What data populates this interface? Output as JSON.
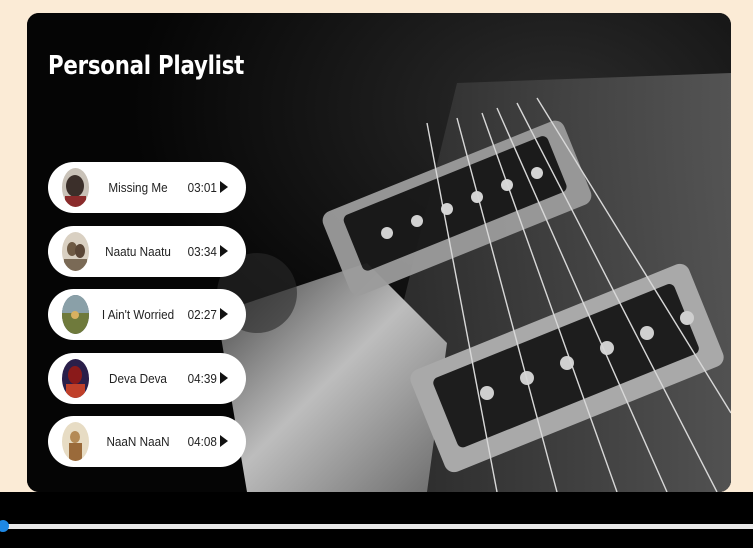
{
  "playlist": {
    "title": "Personal Playlist",
    "songs": [
      {
        "name": "Missing Me",
        "duration": "03:01",
        "thumb_colors": [
          "#3b2f2a",
          "#c9c2b8"
        ]
      },
      {
        "name": "Naatu Naatu",
        "duration": "03:34",
        "thumb_colors": [
          "#6e5a44",
          "#d9d0c2"
        ]
      },
      {
        "name": "I Ain't Worried",
        "duration": "02:27",
        "thumb_colors": [
          "#6f7a3c",
          "#2f4a5a"
        ]
      },
      {
        "name": "Deva Deva",
        "duration": "04:39",
        "thumb_colors": [
          "#8a1a1a",
          "#2a1f4a"
        ]
      },
      {
        "name": "NaaN NaaN",
        "duration": "04:08",
        "thumb_colors": [
          "#e7dcc4",
          "#b48a56"
        ]
      }
    ]
  },
  "player": {
    "progress": 0.0,
    "accent_color": "#1e88e5"
  },
  "colors": {
    "page_background": "#fbebd6",
    "card_background": "#050505"
  }
}
